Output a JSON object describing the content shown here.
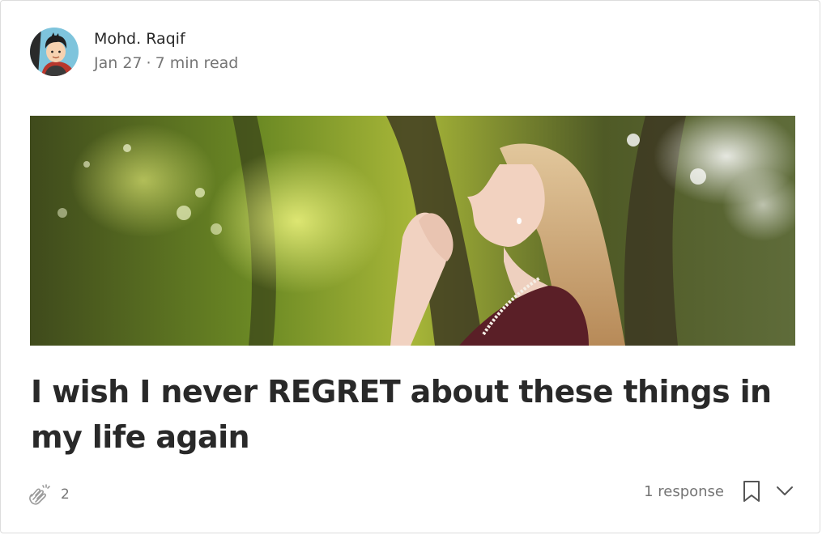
{
  "post": {
    "author": {
      "name": "Mohd. Raqif",
      "avatar_icon": "cartoon-avatar-icon"
    },
    "meta": {
      "date": "Jan 27",
      "separator": "·",
      "read_time": "7 min read"
    },
    "hero_image": {
      "subject": "woman-praying-outdoors",
      "icon": "hero-image"
    },
    "title": "I wish I never REGRET about these things in my life again",
    "claps": {
      "icon": "clap-icon",
      "count": "2"
    },
    "responses": "1 response",
    "bookmark_icon": "bookmark-icon",
    "more_icon": "chevron-down-icon"
  },
  "colors": {
    "text_primary": "#292929",
    "text_secondary": "#757575",
    "border": "#dcdcdc"
  }
}
